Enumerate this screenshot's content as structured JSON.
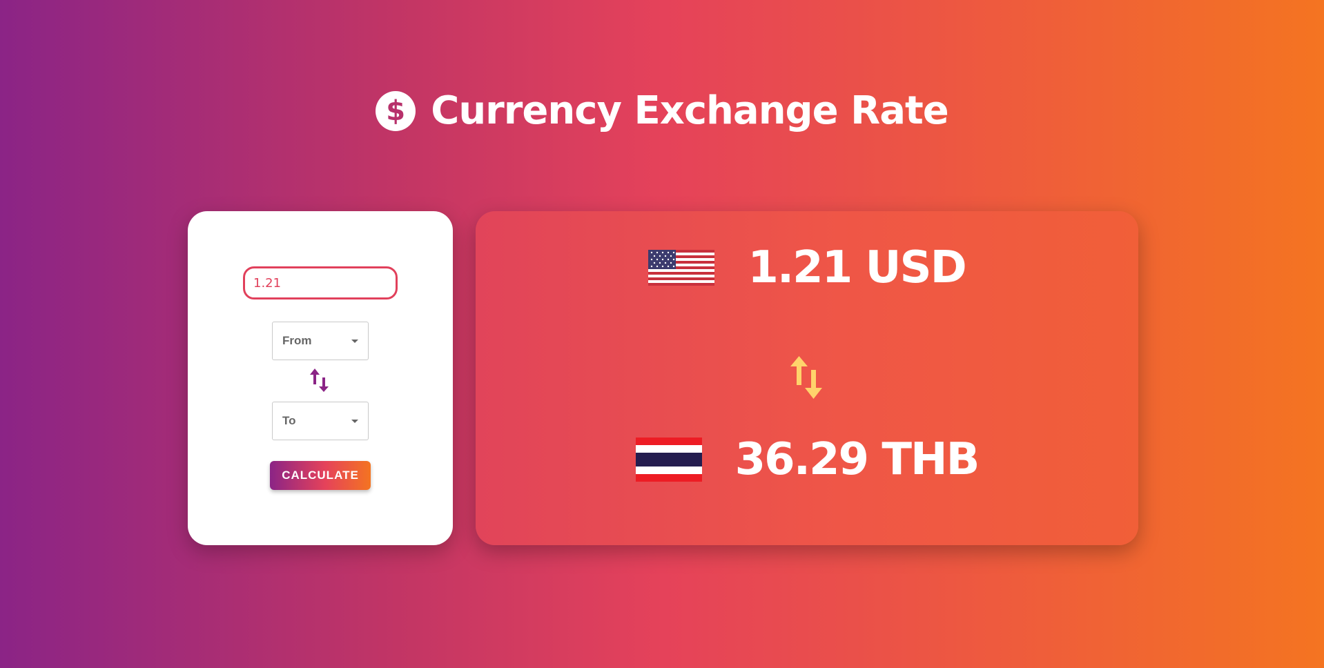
{
  "header": {
    "icon": "dollar-circle-icon",
    "icon_glyph": "$",
    "title": "Currency Exchange Rate"
  },
  "form": {
    "amount_value": "1.21",
    "from_select": {
      "label": "From"
    },
    "to_select": {
      "label": "To"
    },
    "swap_icon": "swap-arrows-icon",
    "calculate_label": "CALCULATE"
  },
  "result": {
    "from": {
      "flag": "us-flag-icon",
      "text": "1.21 USD"
    },
    "to": {
      "flag": "thailand-flag-icon",
      "text": "36.29 THB"
    },
    "swap_icon": "swap-arrows-icon"
  },
  "colors": {
    "gradient_start": "#8b2486",
    "gradient_mid": "#e5425a",
    "gradient_end": "#f47421",
    "input_border": "#e1405b",
    "swap_icon_small": "#8b2486",
    "swap_icon_big": "#ffd36b"
  }
}
